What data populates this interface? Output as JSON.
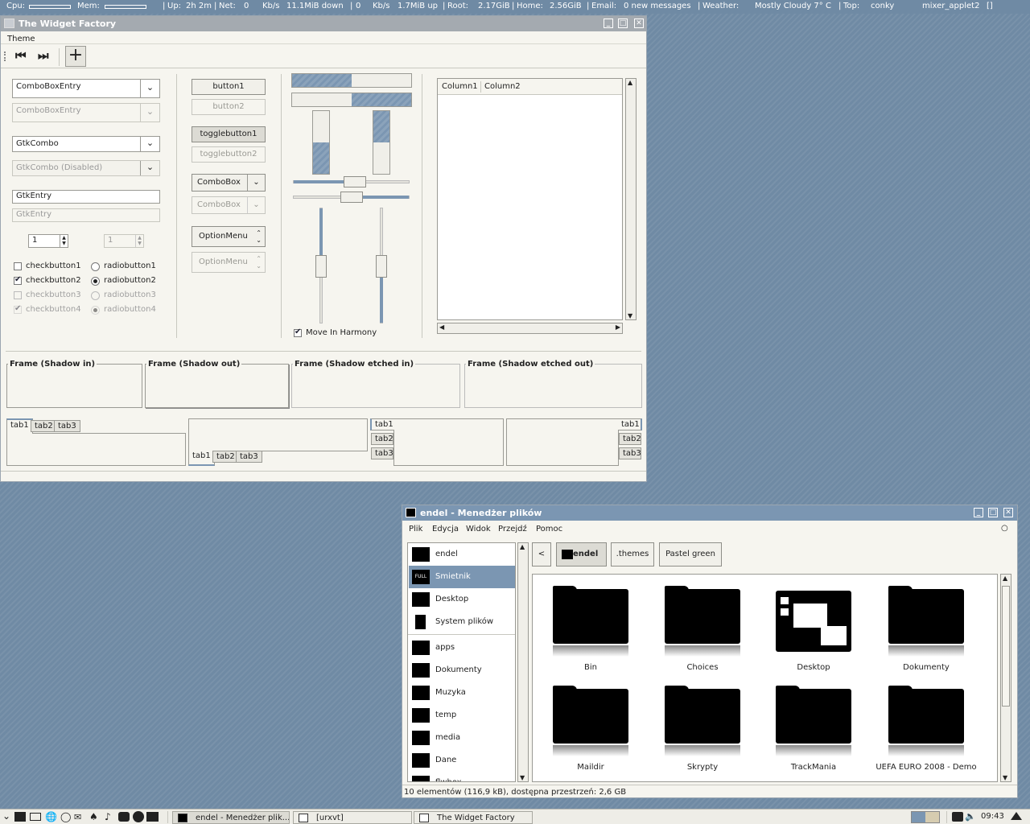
{
  "topbar": {
    "cpu_label": "Cpu:",
    "mem_label": "Mem:",
    "up_label": "Up:",
    "up_value": "2h 2m",
    "net_label": "Net:",
    "down_rate": "0",
    "down_unit": "Kb/s",
    "down_total": "11.1MiB down",
    "up_rate": "0",
    "up_unit": "Kb/s",
    "up_total": "1.7MiB up",
    "root_label": "Root:",
    "root_value": "2.17GiB",
    "home_label": "Home:",
    "home_value": "2.56GiB",
    "email_label": "Email:",
    "email_value": "0 new messages",
    "weather_label": "Weather:",
    "weather_value": "Mostly Cloudy 7° C",
    "top_label": "Top:",
    "top_proc1": "conky",
    "top_proc2": "mixer_applet2",
    "sep": "|",
    "bracket": "[]"
  },
  "widget_factory": {
    "title": "The Widget Factory",
    "menu": [
      "Theme"
    ],
    "combo_entry_1": "ComboBoxEntry",
    "combo_entry_2": "ComboBoxEntry",
    "gtk_combo_1": "GtkCombo",
    "gtk_combo_2": "GtkCombo (Disabled)",
    "entry_1": "GtkEntry",
    "entry_2": "GtkEntry",
    "spin_1": "1",
    "spin_2": "1",
    "checks": [
      {
        "label": "checkbutton1"
      },
      {
        "label": "checkbutton2"
      },
      {
        "label": "checkbutton3"
      },
      {
        "label": "checkbutton4"
      }
    ],
    "radios": [
      {
        "label": "radiobutton1"
      },
      {
        "label": "radiobutton2"
      },
      {
        "label": "radiobutton3"
      },
      {
        "label": "radiobutton4"
      }
    ],
    "button1": "button1",
    "button2": "button2",
    "toggle1": "togglebutton1",
    "toggle2": "togglebutton2",
    "combobox_1": "ComboBox",
    "combobox_2": "ComboBox",
    "option_1": "OptionMenu",
    "option_2": "OptionMenu",
    "progress": {
      "h1": 0.5,
      "h2": 0.5,
      "v1": 0.5,
      "v2": 0.5
    },
    "move_harmony": "Move In Harmony",
    "tree_columns": [
      "Column1",
      "Column2"
    ],
    "frames": [
      "Frame (Shadow in)",
      "Frame (Shadow out)",
      "Frame (Shadow etched in)",
      "Frame (Shadow etched out)"
    ],
    "tabs": [
      "tab1",
      "tab2",
      "tab3"
    ]
  },
  "file_manager": {
    "title": "endel - Menedżer plików",
    "menu": [
      "Plik",
      "Edycja",
      "Widok",
      "Przejdź",
      "Pomoc"
    ],
    "sidebar": [
      {
        "label": "endel",
        "selected": false
      },
      {
        "label": "Smietnik",
        "selected": true
      },
      {
        "label": "Desktop",
        "selected": false
      },
      {
        "label": "System plików",
        "selected": false
      },
      {
        "label": "apps",
        "selected": false
      },
      {
        "label": "Dokumenty",
        "selected": false
      },
      {
        "label": "Muzyka",
        "selected": false
      },
      {
        "label": "temp",
        "selected": false
      },
      {
        "label": "media",
        "selected": false
      },
      {
        "label": "Dane",
        "selected": false
      },
      {
        "label": "flwbox",
        "selected": false
      }
    ],
    "trash_badge": "FULL",
    "back": "<",
    "path": [
      "endel",
      ".themes",
      "Pastel green"
    ],
    "items": [
      "Bin",
      "Choices",
      "Desktop",
      "Dokumenty",
      "Maildir",
      "Skrypty",
      "TrackMania",
      "UEFA EURO 2008 - Demo"
    ],
    "status": "10 elementów (116,9 kB), dostępna przestrzeń: 2,6 GB"
  },
  "taskbar": {
    "tasks": [
      "endel - Menedżer plik...",
      "[urxvt]",
      "The Widget Factory"
    ],
    "clock": "09:43"
  },
  "colors": {
    "accent": "#7b96b2",
    "desktop": "#6f8aa4",
    "window_bg": "#f6f5ef"
  }
}
